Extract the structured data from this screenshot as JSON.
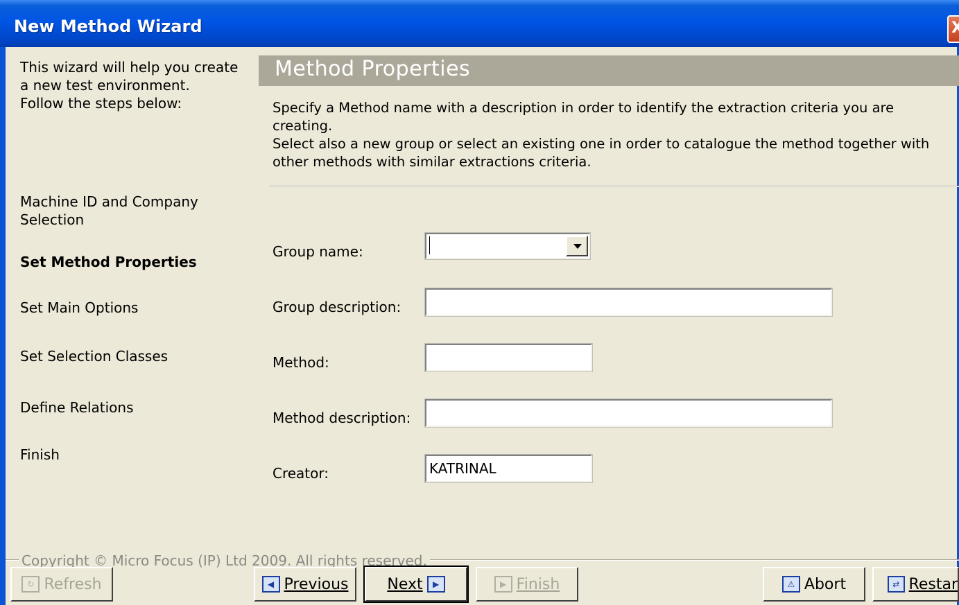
{
  "window": {
    "title": "New Method Wizard",
    "close_glyph": "X"
  },
  "sidebar": {
    "intro": "This wizard will help you create a new test environment. Follow the steps below:",
    "intro_lines": [
      "This wizard will help you create",
      "a new test environment.",
      "Follow the steps below:"
    ],
    "steps": [
      {
        "label_lines": [
          "Machine ID and Company",
          "Selection"
        ],
        "current": false
      },
      {
        "label_lines": [
          "Set Method Properties"
        ],
        "current": true
      },
      {
        "label_lines": [
          "Set Main Options"
        ],
        "current": false
      },
      {
        "label_lines": [
          "Set Selection Classes"
        ],
        "current": false
      },
      {
        "label_lines": [
          "Define Relations"
        ],
        "current": false
      },
      {
        "label_lines": [
          "Finish"
        ],
        "current": false
      }
    ]
  },
  "page": {
    "title": "Method Properties",
    "description_lines": [
      "Specify a Method name with a description in order to identify the extraction criteria you are creating.",
      "Select also a new group or select an existing one in order to catalogue the method together with",
      "other methods with similar extractions criteria."
    ]
  },
  "form": {
    "group_name_label": "Group name:",
    "group_name_value": "",
    "group_description_label": "Group description:",
    "group_description_value": "",
    "method_label": "Method:",
    "method_value": "",
    "method_description_label": "Method description:",
    "method_description_value": "",
    "creator_label": "Creator:",
    "creator_value": "KATRINAL"
  },
  "footer": {
    "copyright": "Copyright © Micro Focus (IP) Ltd 2009. All rights reserved.",
    "buttons": {
      "refresh": {
        "label": "Refresh",
        "icon": "refresh-icon",
        "enabled": false
      },
      "previous": {
        "label": "Previous",
        "icon": "previous-arrow-icon",
        "enabled": true
      },
      "next": {
        "label": "Next",
        "icon": "next-arrow-icon",
        "enabled": true
      },
      "finish": {
        "label": "Finish",
        "icon": "finish-icon",
        "enabled": false
      },
      "abort": {
        "label": "Abort",
        "icon": "abort-warning-icon",
        "enabled": true
      },
      "restart": {
        "label": "Restar",
        "icon": "restart-icon",
        "enabled": true
      }
    }
  }
}
